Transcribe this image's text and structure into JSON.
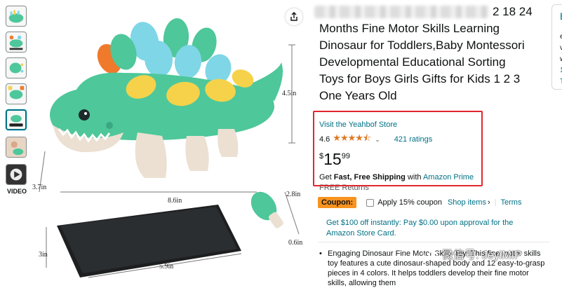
{
  "thumbnails": {
    "items": [
      {
        "name": "thumb-1"
      },
      {
        "name": "thumb-2"
      },
      {
        "name": "thumb-3"
      },
      {
        "name": "thumb-4"
      },
      {
        "name": "thumb-5"
      },
      {
        "name": "thumb-6"
      }
    ],
    "video_label": "VIDEO"
  },
  "main_image": {
    "dimensions": {
      "height": "4.5in",
      "width_top": "8.6in",
      "left_height": "3.7in",
      "side_length": "2.8in",
      "small_height": "0.6in",
      "phone_height": "3in",
      "phone_width": "5.9in"
    },
    "colors": {
      "toy_green": "#4ec79a",
      "toy_body": "#ebe0d2",
      "spike_blue": "#7fd6e6",
      "spike_yellow": "#f5d24a",
      "spike_orange": "#f07a2c"
    }
  },
  "share_icon": "share-icon",
  "title": {
    "top_line_visible": "2 18 24",
    "text": "Months Fine Motor Skills Learning Dinosaur for Toddlers,Baby Montessori Developmental Educational Sorting Toys for Boys Girls Gifts for Kids 1 2 3 One Years Old"
  },
  "store": {
    "link": "Visit the Yeahbof Store"
  },
  "rating": {
    "value": "4.6",
    "stars": "★★★★⯪",
    "count_link": "421 ratings"
  },
  "price": {
    "symbol": "$",
    "whole": "15",
    "fraction": "99"
  },
  "shipping": {
    "prefix": "Get ",
    "bold": "Fast, Free Shipping",
    "with": " with ",
    "prime": "Amazon Prime"
  },
  "returns": "FREE Returns",
  "coupon": {
    "badge": "Coupon:",
    "apply_text": "Apply 15% coupon",
    "shop_items": "Shop items",
    "shop_chev": "›",
    "separator": "|",
    "terms": "Terms"
  },
  "promo": "Get $100 off instantly: Pay $0.00 upon approval for the Amazon Store Card.",
  "bullet": {
    "text": "Engaging Dinosaur Fine Motor Skills Toy: This fine motor skills toy features a cute dinosaur-shaped body and 12 easy-to-grasp pieces in 4 colors. It helps toddlers develop their fine motor skills, allowing them"
  },
  "watermark": {
    "text": "微信号: JeyiMIP"
  },
  "right_strip": {
    "chars": [
      "B",
      "e",
      "v",
      "w",
      "1",
      "T"
    ]
  },
  "highlight_color": "#e3262d"
}
